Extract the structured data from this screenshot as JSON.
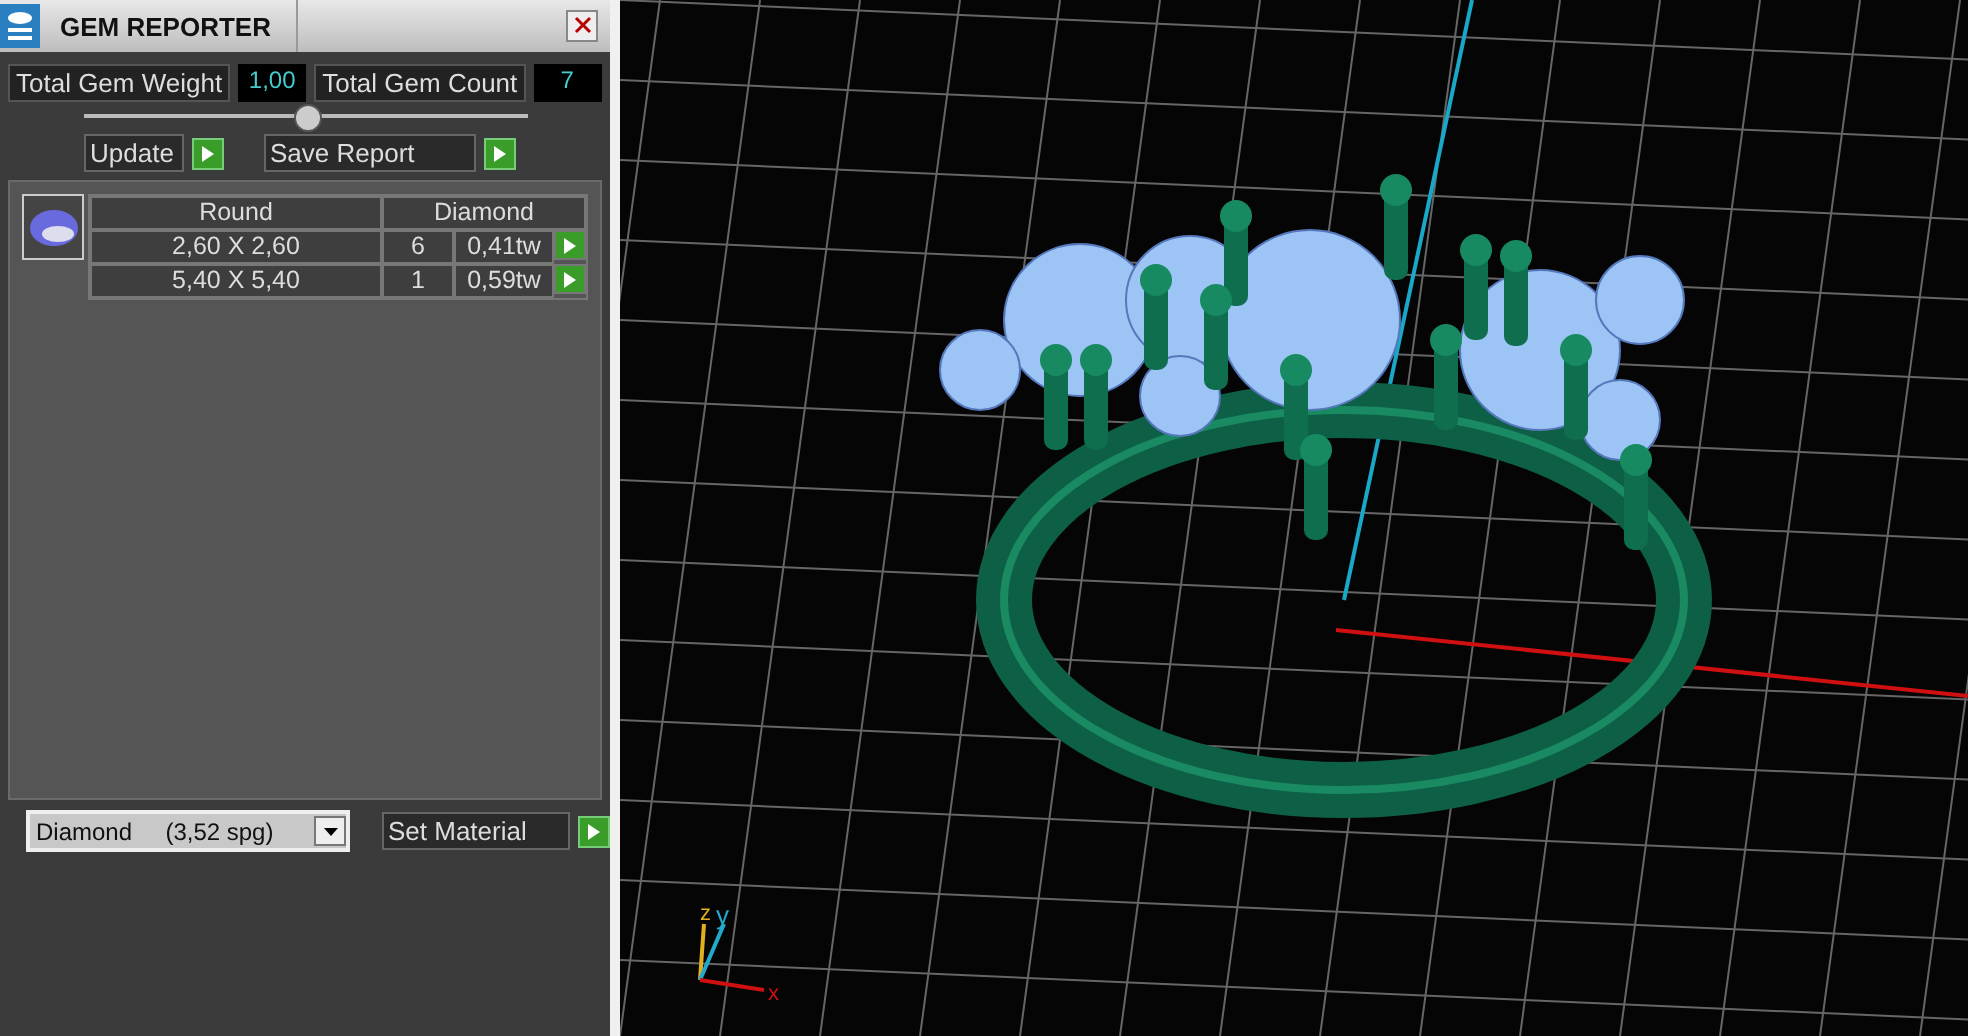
{
  "panel": {
    "title": "GEM REPORTER",
    "stats": [
      {
        "label": "Total Gem Weight",
        "value": "1,00"
      },
      {
        "label": "Total Gem Count",
        "value": "7"
      }
    ],
    "slider": {
      "level": 0.5
    },
    "actions": [
      "Update",
      "Save Report"
    ],
    "gem_table": {
      "header": [
        "Round",
        "Diamond"
      ],
      "rows": [
        {
          "size": "2,60 X 2,60",
          "count": "6",
          "weight": "0,41tw"
        },
        {
          "size": "5,40 X 5,40",
          "count": "1",
          "weight": "0,59tw"
        }
      ]
    },
    "material": {
      "value": "Diamond     (3,52 spg)",
      "button": "Set Material"
    }
  },
  "viewport": {
    "axes": [
      "z",
      "y",
      "x"
    ]
  }
}
